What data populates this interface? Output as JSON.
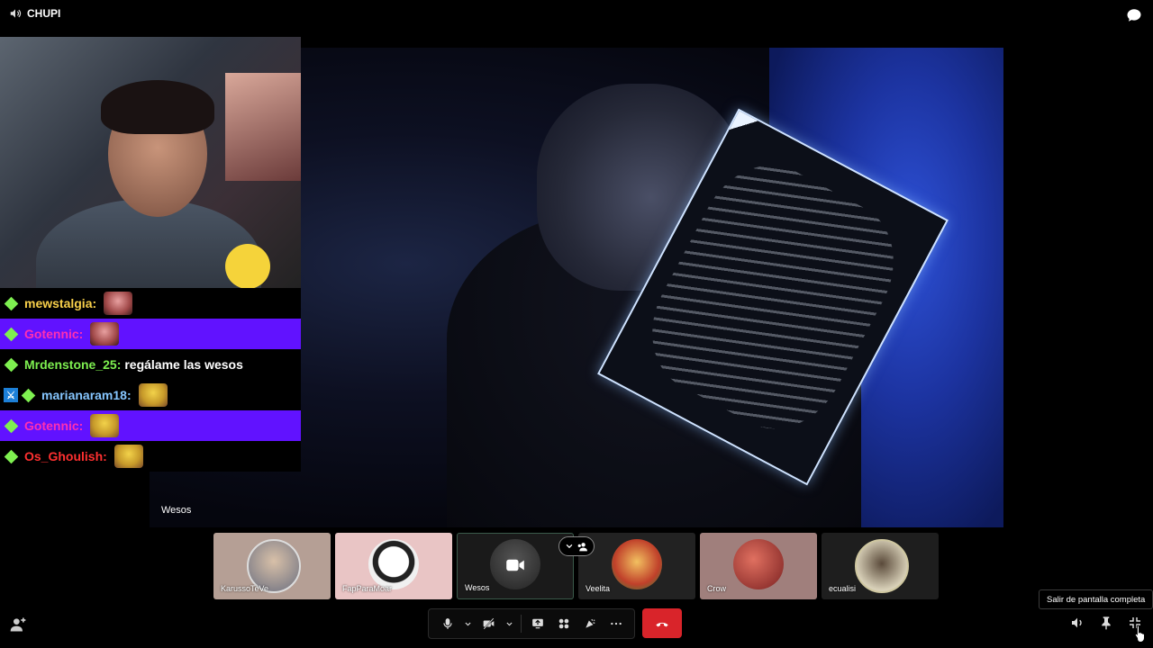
{
  "header": {
    "channel_name": "CHUPI",
    "speaker_icon": "speaker-icon",
    "chat_icon": "chat-bubble-icon"
  },
  "main_video": {
    "label": "Wesos"
  },
  "chat": {
    "messages": [
      {
        "user": "mewstalgia:",
        "user_color": "#f8d04a",
        "text": "",
        "highlight": false,
        "mod": false
      },
      {
        "user": "Gotennic:",
        "user_color": "#ff2fb2",
        "text": "",
        "highlight": true,
        "mod": false
      },
      {
        "user": "Mrdenstone_25:",
        "user_color": "#7ef050",
        "text": "regálame las wesos",
        "highlight": false,
        "mod": false
      },
      {
        "user": "marianaram18:",
        "user_color": "#86c6ff",
        "text": "",
        "highlight": false,
        "mod": true
      },
      {
        "user": "Gotennic:",
        "user_color": "#ff2fb2",
        "text": "",
        "highlight": true,
        "mod": false
      },
      {
        "user": "Os_Ghoulish:",
        "user_color": "#ff3030",
        "text": "",
        "highlight": false,
        "mod": false
      }
    ]
  },
  "participants": [
    {
      "name": "KarussoTeVe"
    },
    {
      "name": "FapParaMoar"
    },
    {
      "name": "Wesos"
    },
    {
      "name": "Veelita"
    },
    {
      "name": "Crow"
    },
    {
      "name": "ecualisi"
    }
  ],
  "controls": {
    "mic": "microphone-icon",
    "camera": "camera-off-icon",
    "share": "screen-share-icon",
    "activities": "activities-icon",
    "soundboard": "soundboard-icon",
    "more": "more-icon",
    "hangup": "hang-up-icon",
    "hangup_color": "#d9242a"
  },
  "right_controls": {
    "volume": "volume-icon",
    "pin": "pin-icon",
    "exit_fullscreen": "exit-fullscreen-icon"
  },
  "tooltip": {
    "text": "Salir de pantalla completa"
  },
  "colors": {
    "highlight": "#6112ff",
    "badge_diamond": "#7ef050",
    "mod_badge": "#1d80d8"
  }
}
